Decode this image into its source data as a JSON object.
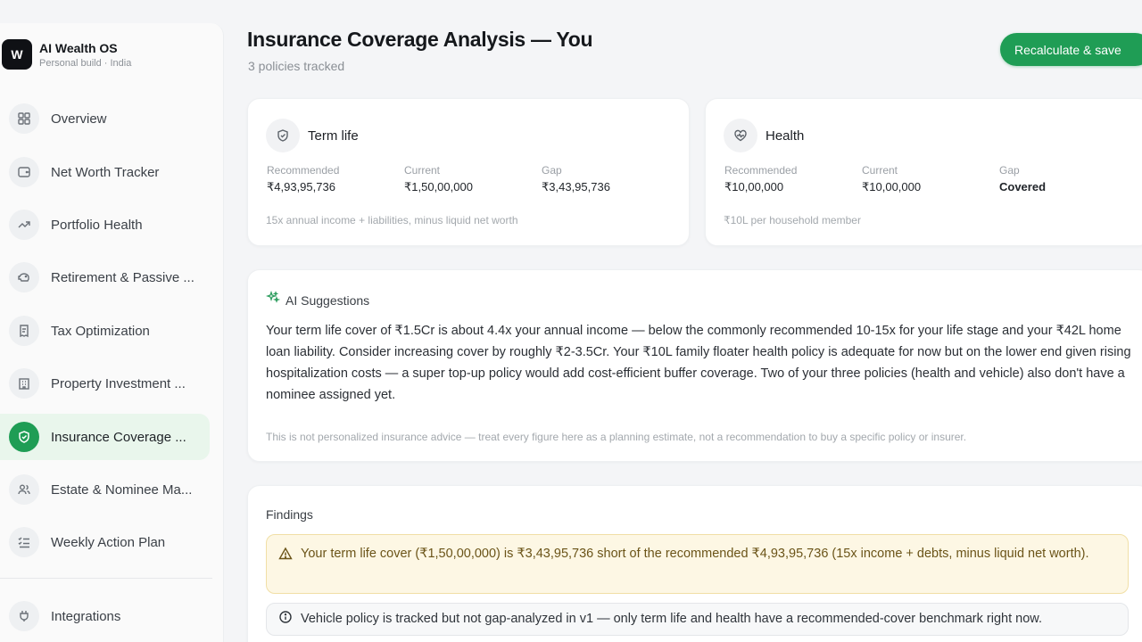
{
  "sidebar": {
    "brand": {
      "logo": "W",
      "name": "AI Wealth OS",
      "subtitle": "Personal build · India"
    },
    "items": [
      {
        "label": "Overview",
        "icon": "grid-icon"
      },
      {
        "label": "Net Worth Tracker",
        "icon": "wallet-icon"
      },
      {
        "label": "Portfolio Health",
        "icon": "trend-up-icon"
      },
      {
        "label": "Retirement & Passive ...",
        "icon": "piggy-bank-icon"
      },
      {
        "label": "Tax Optimization",
        "icon": "receipt-icon"
      },
      {
        "label": "Property Investment ...",
        "icon": "building-icon"
      },
      {
        "label": "Insurance Coverage ...",
        "icon": "shield-check-icon",
        "active": true
      },
      {
        "label": "Estate & Nominee Ma...",
        "icon": "users-icon"
      },
      {
        "label": "Weekly Action Plan",
        "icon": "list-checks-icon"
      }
    ],
    "footer_item": {
      "label": "Integrations",
      "icon": "plug-icon"
    }
  },
  "header": {
    "title": "Insurance Coverage Analysis — You",
    "subtitle": "3 policies tracked",
    "primary_button": "Recalculate & save"
  },
  "coverage_cards": [
    {
      "title": "Term life",
      "icon": "shield-icon",
      "recommended_label": "Recommended",
      "recommended": "₹4,93,95,736",
      "current_label": "Current",
      "current": "₹1,50,00,000",
      "gap_label": "Gap",
      "gap": "₹3,43,95,736",
      "note": "15x annual income + liabilities, minus liquid net worth"
    },
    {
      "title": "Health",
      "icon": "heart-pulse-icon",
      "recommended_label": "Recommended",
      "recommended": "₹10,00,000",
      "current_label": "Current",
      "current": "₹10,00,000",
      "gap_label": "Gap",
      "gap": "Covered",
      "note": "₹10L per household member"
    }
  ],
  "suggestions": {
    "title": "AI Suggestions",
    "icon": "sparkles-icon",
    "body": "Your term life cover of ₹1.5Cr is about 4.4x your annual income — below the commonly recommended 10-15x for your life stage and your ₹42L home loan liability. Consider increasing cover by roughly ₹2-3.5Cr. Your ₹10L family floater health policy is adequate for now but on the lower end given rising hospitalization costs — a super top-up policy would add cost-efficient buffer coverage. Two of your three policies (health and vehicle) also don't have a nominee assigned yet.",
    "disclaimer": "This is not personalized insurance advice — treat every figure here as a planning estimate, not a recommendation to buy a specific policy or insurer."
  },
  "findings": {
    "title": "Findings",
    "items": [
      {
        "type": "warning",
        "icon": "warning-triangle-icon",
        "text": "Your term life cover (₹1,50,00,000) is ₹3,43,95,736 short of the recommended ₹4,93,95,736 (15x income + debts, minus liquid net worth)."
      },
      {
        "type": "info",
        "icon": "info-circle-icon",
        "text": "Vehicle policy is tracked but not gap-analyzed in v1 — only term life and health have a recommended-cover benchmark right now."
      }
    ]
  },
  "colors": {
    "accent": "#1f9d55",
    "active_bg": "#e9f6ec",
    "warning_bg": "#fdf7e4",
    "warning_border": "#f1dfa6"
  }
}
